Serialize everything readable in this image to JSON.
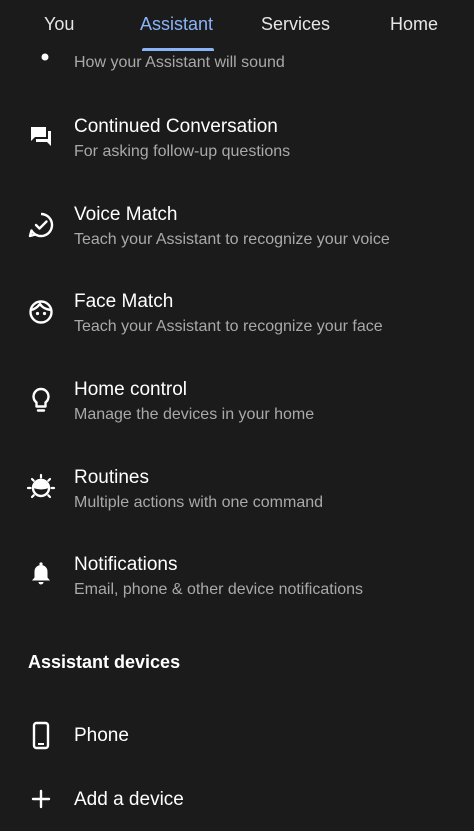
{
  "tabs": [
    {
      "label": "You"
    },
    {
      "label": "Assistant"
    },
    {
      "label": "Services"
    },
    {
      "label": "Home"
    }
  ],
  "active_tab": "Assistant",
  "settings": {
    "voice": {
      "subtitle": "How your Assistant will sound"
    },
    "items": [
      {
        "title": "Continued Conversation",
        "subtitle": "For asking follow-up questions",
        "icon": "chat-icon"
      },
      {
        "title": "Voice Match",
        "subtitle": "Teach your Assistant to recognize your voice",
        "icon": "voice-match-icon"
      },
      {
        "title": "Face Match",
        "subtitle": "Teach your Assistant to recognize your face",
        "icon": "face-icon"
      },
      {
        "title": "Home control",
        "subtitle": "Manage the devices in your home",
        "icon": "lightbulb-icon"
      },
      {
        "title": "Routines",
        "subtitle": "Multiple actions with one command",
        "icon": "routines-icon"
      },
      {
        "title": "Notifications",
        "subtitle": "Email, phone & other device notifications",
        "icon": "bell-icon"
      }
    ]
  },
  "devices_section": {
    "header": "Assistant devices",
    "items": [
      {
        "label": "Phone",
        "icon": "phone-icon"
      },
      {
        "label": "Add a device",
        "icon": "plus-icon"
      }
    ]
  },
  "colors": {
    "background": "#1b1b1b",
    "accent": "#8ab4f8",
    "primary_text": "#ffffff",
    "secondary_text": "#a9a9a9"
  }
}
